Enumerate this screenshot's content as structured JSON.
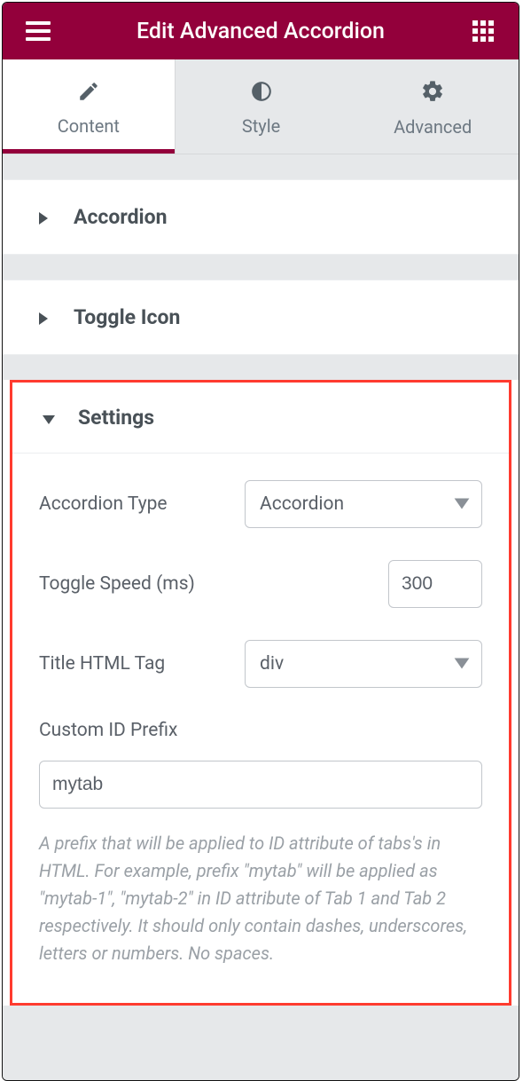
{
  "header": {
    "title": "Edit Advanced Accordion"
  },
  "tabs": {
    "content": "Content",
    "style": "Style",
    "advanced": "Advanced"
  },
  "sections": {
    "accordion": "Accordion",
    "toggle_icon": "Toggle Icon",
    "settings": "Settings"
  },
  "settings": {
    "accordion_type": {
      "label": "Accordion Type",
      "value": "Accordion"
    },
    "toggle_speed": {
      "label": "Toggle Speed (ms)",
      "value": "300"
    },
    "title_html_tag": {
      "label": "Title HTML Tag",
      "value": "div"
    },
    "custom_id_prefix": {
      "label": "Custom ID Prefix",
      "value": "mytab",
      "description": "A prefix that will be applied to ID attribute of tabs's in HTML. For example, prefix \"mytab\" will be applied as \"mytab-1\", \"mytab-2\" in ID attribute of Tab 1 and Tab 2 respectively. It should only contain dashes, underscores, letters or numbers. No spaces."
    }
  }
}
